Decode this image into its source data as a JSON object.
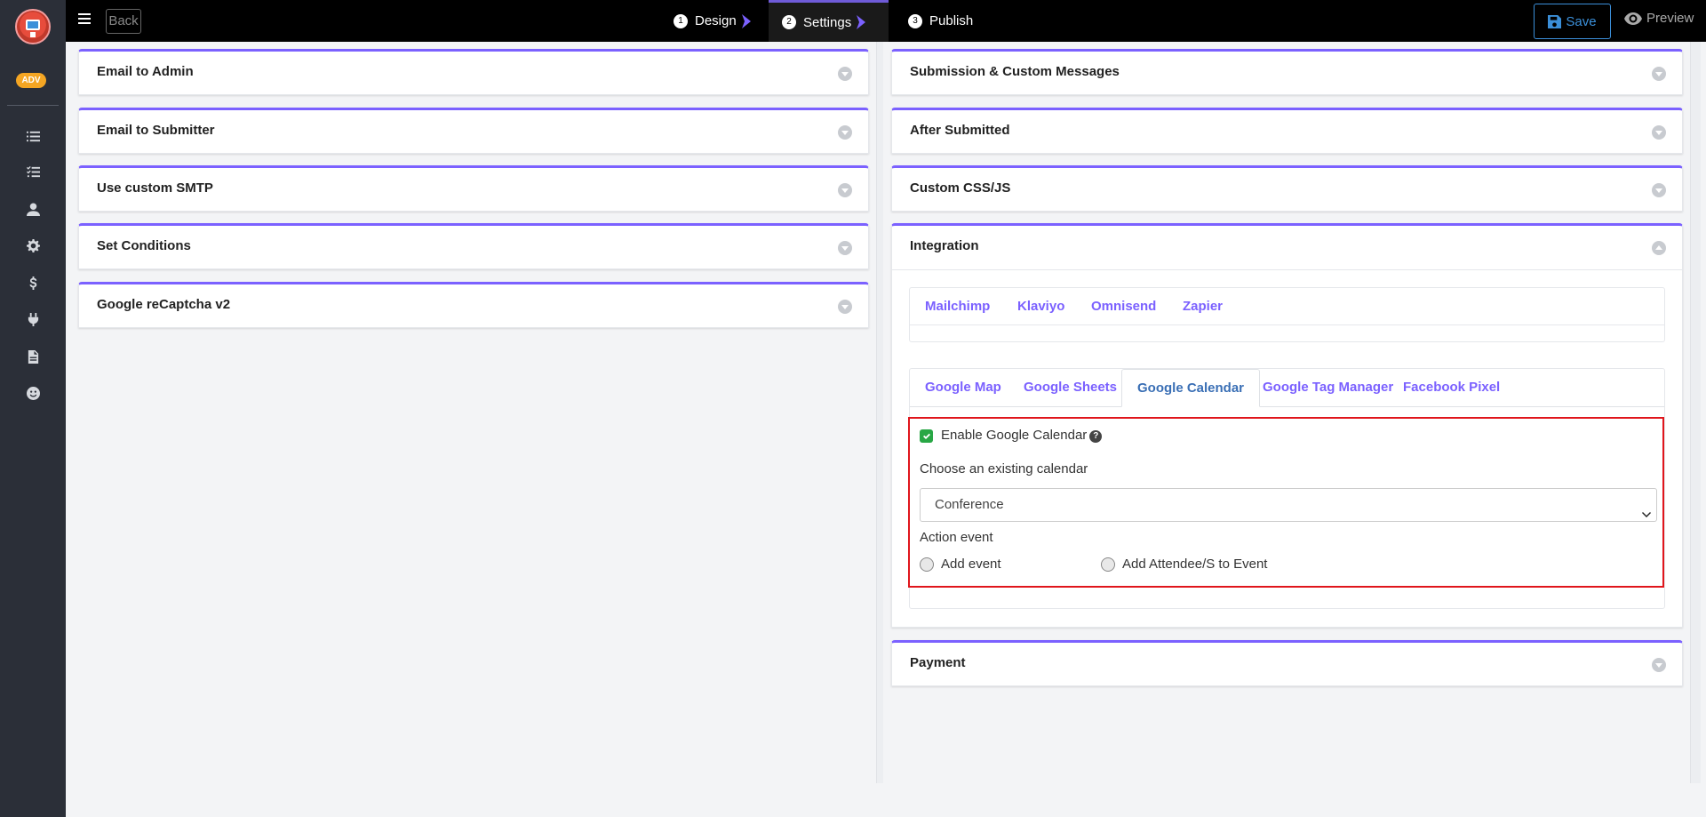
{
  "sidebar": {
    "badge": "ADV",
    "icons": [
      "list-icon",
      "checklist-icon",
      "user-icon",
      "gear-icon",
      "dollar-icon",
      "plug-icon",
      "document-icon",
      "smiley-icon"
    ]
  },
  "topbar": {
    "back_label": "Back",
    "steps": [
      {
        "num": "1",
        "label": "Design"
      },
      {
        "num": "2",
        "label": "Settings"
      },
      {
        "num": "3",
        "label": "Publish"
      }
    ],
    "save_label": "Save",
    "preview_label": "Preview"
  },
  "left_panels": [
    {
      "title": "Email to Admin"
    },
    {
      "title": "Email to Submitter"
    },
    {
      "title": "Use custom SMTP"
    },
    {
      "title": "Set Conditions"
    },
    {
      "title": "Google reCaptcha v2"
    }
  ],
  "right_panels": {
    "submission": "Submission & Custom Messages",
    "after_submitted": "After Submitted",
    "custom_css": "Custom CSS/JS",
    "integration": "Integration",
    "payment": "Payment"
  },
  "integration": {
    "tabs_row1": [
      "Mailchimp",
      "Klaviyo",
      "Omnisend",
      "Zapier"
    ],
    "tabs_row2": [
      "Google Map",
      "Google Sheets",
      "Google Calendar",
      "Google Tag Manager",
      "Facebook Pixel"
    ],
    "selected_tab": "Google Calendar",
    "gcal": {
      "enable_label": "Enable Google Calendar",
      "enabled": true,
      "choose_label": "Choose an existing calendar",
      "calendar_value": "Conference",
      "action_label": "Action event",
      "radio_add_event": "Add event",
      "radio_add_attendee": "Add Attendee/S to Event"
    }
  },
  "colors": {
    "accent": "#7b61ff",
    "tab_selected": "#3a6fb5",
    "highlight_border": "#e0161c",
    "checkbox": "#28a745",
    "badge": "#f5a623"
  }
}
